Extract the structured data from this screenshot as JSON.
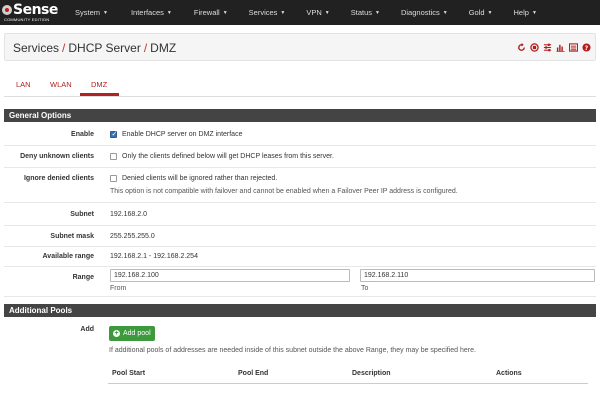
{
  "nav": {
    "logo_text": "Sense",
    "logo_sub": "COMMUNITY EDITION",
    "items": [
      "System",
      "Interfaces",
      "Firewall",
      "Services",
      "VPN",
      "Status",
      "Diagnostics",
      "Gold",
      "Help"
    ]
  },
  "breadcrumb": {
    "part1": "Services",
    "part2": "DHCP Server",
    "part3": "DMZ",
    "sep": "/"
  },
  "header_icons": [
    "restart-icon",
    "stop-icon",
    "settings-icon",
    "chart-icon",
    "list-icon",
    "help-icon"
  ],
  "tabs": [
    "LAN",
    "WLAN",
    "DMZ"
  ],
  "active_tab": "DMZ",
  "general": {
    "heading": "General Options",
    "enable_label": "Enable",
    "enable_text": "Enable DHCP server on DMZ interface",
    "enable_checked": true,
    "deny_label": "Deny unknown clients",
    "deny_text": "Only the clients defined below will get DHCP leases from this server.",
    "deny_checked": false,
    "ignore_label": "Ignore denied clients",
    "ignore_text": "Denied clients will be ignored rather than rejected.",
    "ignore_help": "This option is not compatible with failover and cannot be enabled when a Failover Peer IP address is configured.",
    "ignore_checked": false,
    "subnet_label": "Subnet",
    "subnet_value": "192.168.2.0",
    "mask_label": "Subnet mask",
    "mask_value": "255.255.255.0",
    "avail_label": "Available range",
    "avail_value": "192.168.2.1 - 192.168.2.254",
    "range_label": "Range",
    "range_from": "192.168.2.100",
    "range_to": "192.168.2.110",
    "from_label": "From",
    "to_label": "To"
  },
  "pools": {
    "heading": "Additional Pools",
    "add_label": "Add",
    "add_button": "Add pool",
    "help": "If additional pools of addresses are needed inside of this subnet outside the above Range, they may be specified here.",
    "columns": [
      "Pool Start",
      "Pool End",
      "Description",
      "Actions"
    ]
  },
  "colors": {
    "navbar": "#212121",
    "accent": "#b22222",
    "panel_heading": "#444444",
    "add_button": "#3c9a3c"
  }
}
